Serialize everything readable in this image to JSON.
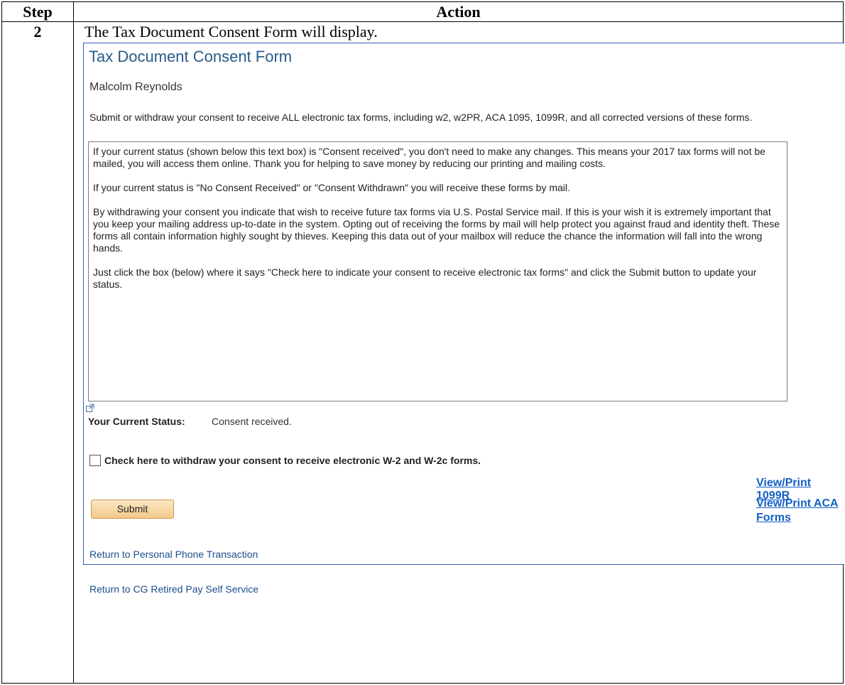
{
  "table": {
    "header_step": "Step",
    "header_action": "Action",
    "step_number": "2",
    "step_text": "The Tax Document Consent Form will display."
  },
  "form": {
    "title": "Tax Document Consent Form",
    "user_name": "Malcolm Reynolds",
    "intro": "Submit or withdraw your consent to receive ALL electronic tax forms, including w2, w2PR, ACA 1095, 1099R, and all corrected versions of these forms.",
    "textbox_paragraphs": [
      "If your current status (shown below this text box) is \"Consent received\", you don't need to make any changes. This means your 2017 tax forms will not be mailed, you will access them online. Thank you for helping to save money by reducing our printing and mailing costs.",
      "If your current status is \"No Consent Received\" or  \"Consent Withdrawn\" you will  receive these forms by mail.",
      "By withdrawing your consent you indicate that wish to receive future tax forms via U.S. Postal Service mail. If this is your wish it is extremely important that you keep your mailing address up-to-date in the system. Opting out of receiving the forms by mail will help protect you against fraud and identity theft. These forms all contain information highly sought by thieves. Keeping this data out of your mailbox will reduce the chance the information will fall into the wrong hands.",
      "Just click the box (below) where it says \"Check here to indicate your consent to receive electronic tax forms\" and click the Submit button to update your status."
    ],
    "status_label": "Your Current Status:",
    "status_value": "Consent received.",
    "checkbox_label": "Check here to withdraw your consent to receive electronic W-2 and W-2c forms.",
    "link_1099r": "View/Print 1099R",
    "link_aca": "View/Print ACA Forms",
    "submit_label": "Submit",
    "return_phone": "Return to Personal Phone Transaction",
    "return_self_service": "Return to CG Retired Pay Self Service"
  }
}
